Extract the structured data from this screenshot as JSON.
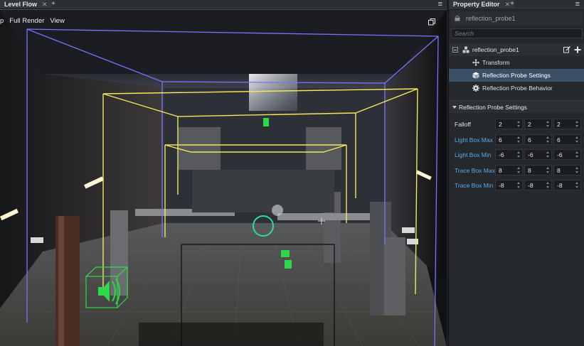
{
  "left_panel": {
    "tab_label": "Level Flow",
    "tab_close": "✕",
    "tab_add": "+",
    "menu_icon": "hamburger-icon",
    "viewport_menu": [
      "p",
      "Full Render",
      "View"
    ],
    "maximize_icon": "maximize-icon"
  },
  "right_panel": {
    "tab_label": "Property Editor",
    "tab_close": "✕",
    "tab_add": "+",
    "object_name": "reflection_probe1",
    "search_placeholder": "Search",
    "tree": {
      "root": "reflection_probe1",
      "children": [
        "Transform",
        "Reflection Probe Settings",
        "Reflection Probe Behavior"
      ],
      "selected_index": 1
    },
    "section_title": "Reflection Probe Settings",
    "properties": [
      {
        "label": "Falloff",
        "values": [
          "2",
          "2",
          "2"
        ]
      },
      {
        "label": "Light Box Max",
        "values": [
          "6",
          "6",
          "6"
        ]
      },
      {
        "label": "Light Box Min",
        "values": [
          "-6",
          "-6",
          "-6"
        ]
      },
      {
        "label": "Trace Box Max",
        "values": [
          "8",
          "8",
          "8"
        ]
      },
      {
        "label": "Trace Box Min",
        "values": [
          "-8",
          "-8",
          "-8"
        ]
      }
    ]
  },
  "colors": {
    "accent_label": "#5fa8e3",
    "selection": "#3b4f66",
    "trace_box": "#7a72ff",
    "light_box": "#f2e85c",
    "gizmo_green": "#2fd84a"
  }
}
